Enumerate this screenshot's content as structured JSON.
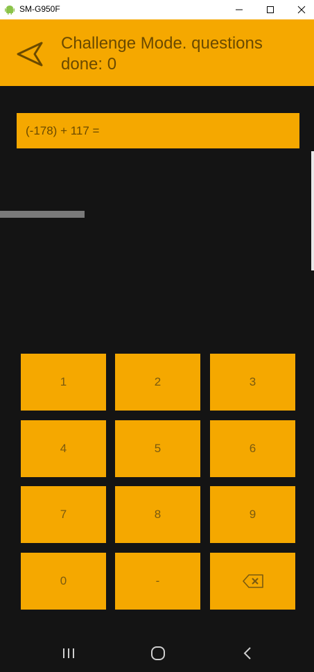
{
  "window": {
    "title": "SM-G950F",
    "controls": [
      "minimize",
      "maximize",
      "close"
    ]
  },
  "appbar": {
    "title": "Challenge Mode. questions done: 0",
    "back_icon": "back-arrow-icon",
    "color": "#f5a800"
  },
  "question": {
    "text": "(-178) + 117 ="
  },
  "timer": {
    "progress_percent": 27
  },
  "keypad": {
    "keys": [
      "1",
      "2",
      "3",
      "4",
      "5",
      "6",
      "7",
      "8",
      "9",
      "0",
      "-",
      "backspace"
    ]
  },
  "navbar": {
    "buttons": [
      "recent-apps-icon",
      "home-icon",
      "back-icon"
    ]
  },
  "colors": {
    "accent": "#f5a800",
    "background": "#141414",
    "text_on_accent": "#6b4a00"
  }
}
